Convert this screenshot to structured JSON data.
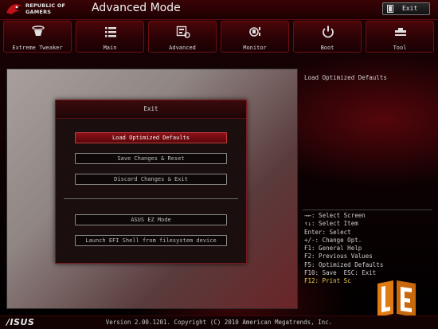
{
  "header": {
    "brand_line1": "REPUBLIC OF",
    "brand_line2": "GAMERS",
    "mode_title": "Advanced Mode",
    "exit_label": "Exit"
  },
  "tabs": [
    {
      "label": "Extreme Tweaker",
      "icon": "tweaker-icon"
    },
    {
      "label": "Main",
      "icon": "list-icon"
    },
    {
      "label": "Advanced",
      "icon": "advanced-icon"
    },
    {
      "label": "Monitor",
      "icon": "monitor-icon"
    },
    {
      "label": "Boot",
      "icon": "power-icon"
    },
    {
      "label": "Tool",
      "icon": "tool-icon"
    }
  ],
  "dialog": {
    "title": "Exit",
    "options": [
      "Load Optimized Defaults",
      "Save Changes & Reset",
      "Discard Changes & Exit",
      "ASUS EZ Mode",
      "Launch EFI Shell from filesystem device"
    ],
    "selected_index": 0
  },
  "help": {
    "description": "Load Optimized Defaults"
  },
  "keys": [
    "→←: Select Screen",
    "↑↓: Select Item",
    "Enter: Select",
    "+/-: Change Opt.",
    "F1: General Help",
    "F2: Previous Values",
    "F5: Optimized Defaults",
    "F10: Save  ESC: Exit",
    "F12: Print Sc"
  ],
  "footer": {
    "brand": "/ISUS",
    "version": "Version 2.00.1201. Copyright (C) 2010 American Megatrends, Inc."
  },
  "colors": {
    "accent": "#8a1117",
    "highlight_key": "#f0d24a",
    "watermark": "#e07a12"
  }
}
